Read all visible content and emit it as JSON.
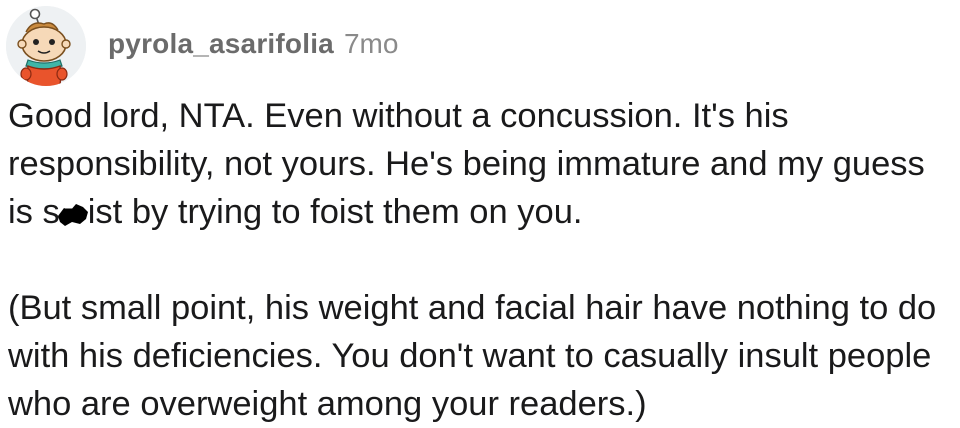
{
  "comment": {
    "avatar_icon": "snoo-avatar-icon",
    "username": "pyrola_asarifolia",
    "age": "7mo",
    "paragraph_1": {
      "before_redaction": "Good lord, NTA. Even without a concussion. It's his responsibility, not yours. He's being immature and my guess is s",
      "after_redaction": "ist by trying to foist them on you."
    },
    "paragraph_2": "(But small point, his weight and facial hair have nothing to do with his deficiencies. You don't want to casually insult people who are overweight among your readers.)",
    "colors": {
      "text": "#1a1a1b",
      "username": "#6b6b6b",
      "age": "#8a8a8a",
      "redaction": "#000000"
    }
  }
}
